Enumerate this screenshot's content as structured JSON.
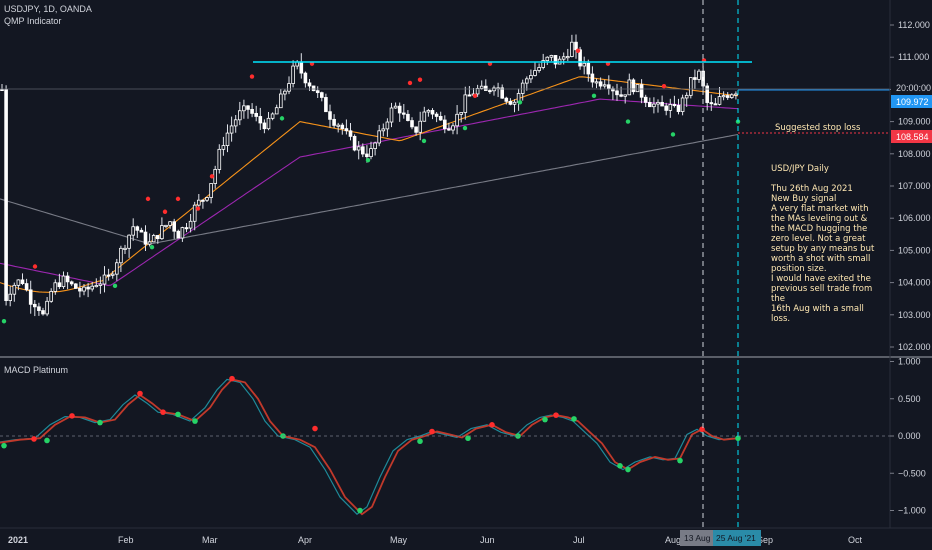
{
  "header": {
    "symbol_line": "USDJPY, 1D, OANDA",
    "indicator": "QMP Indicator",
    "macd_title": "MACD Platinum"
  },
  "colors": {
    "background": "#131722",
    "up_candle": "#ffffff",
    "down_candle": "#ffffff",
    "ma_fast": "#f7931a",
    "ma_mid": "#9c27b0",
    "ma_slow": "#787b86",
    "resistance": "#00e5ff",
    "buy_dot": "#26d367",
    "sell_dot": "#ff2d2d",
    "macd_line": "#c0392b",
    "signal_line": "#1e8a99",
    "price_label": "#2196f3",
    "stop_label": "#f23645"
  },
  "annotations": {
    "stop_loss_label": "Suggested stop loss",
    "note": [
      "USD/JPY Daily",
      "",
      "Thu 26th Aug 2021",
      "New Buy signal",
      "A very flat market with",
      "the MAs leveling out &",
      "the MACD hugging the",
      "zero level.  Not a great",
      "setup by any means but",
      "worth a shot with small",
      "position size.",
      "I would have exited the",
      "previous sell trade from the",
      "16th Aug with a small loss."
    ]
  },
  "price_axis": {
    "ticks": [
      "112.000",
      "111.000",
      "110.000",
      "109.000",
      "108.000",
      "107.000",
      "106.000",
      "105.000",
      "104.000",
      "103.000",
      "102.000"
    ],
    "current_time_label": "20:00:00",
    "current_price": "109.972",
    "stop_price": "108.584"
  },
  "macd_axis": {
    "ticks": [
      "1.000",
      "0.500",
      "0.000",
      "−0.500",
      "−1.000"
    ]
  },
  "time_axis": {
    "labels": [
      "2021",
      "Feb",
      "Mar",
      "Apr",
      "May",
      "Jun",
      "Jul",
      "Aug",
      "Sep",
      "Oct"
    ],
    "marker_1": "13 Aug '21",
    "marker_2": "25 Aug '21"
  },
  "chart_data": [
    {
      "type": "line",
      "title": "USDJPY, 1D, OANDA",
      "x": [
        "2021-01-04",
        "2021-01-15",
        "2021-02-01",
        "2021-02-15",
        "2021-03-01",
        "2021-03-15",
        "2021-03-31",
        "2021-04-15",
        "2021-04-30",
        "2021-05-14",
        "2021-05-31",
        "2021-06-15",
        "2021-06-30",
        "2021-07-15",
        "2021-07-30",
        "2021-08-13",
        "2021-08-26"
      ],
      "series": [
        {
          "name": "close",
          "values": [
            103.2,
            103.8,
            104.9,
            105.5,
            106.6,
            108.9,
            110.7,
            108.8,
            109.3,
            109.4,
            109.6,
            110.0,
            111.1,
            110.1,
            109.7,
            109.6,
            109.97
          ]
        }
      ],
      "ylim": [
        101.8,
        112.5
      ],
      "grid": false
    },
    {
      "type": "line",
      "title": "MACD Platinum",
      "x": [
        "2021-01-04",
        "2021-01-15",
        "2021-02-01",
        "2021-02-15",
        "2021-03-01",
        "2021-03-15",
        "2021-03-31",
        "2021-04-15",
        "2021-04-30",
        "2021-05-14",
        "2021-05-31",
        "2021-06-15",
        "2021-06-30",
        "2021-07-15",
        "2021-07-30",
        "2021-08-13",
        "2021-08-26"
      ],
      "series": [
        {
          "values": [
            -0.1,
            0.25,
            0.12,
            0.5,
            0.25,
            0.55,
            0.35,
            -0.3,
            -1.0,
            -0.3,
            0.0,
            0.15,
            0.28,
            0.05,
            -0.4,
            0.1,
            0.0
          ]
        }
      ],
      "ylim": [
        -1.1,
        1.05
      ],
      "grid": false
    }
  ]
}
